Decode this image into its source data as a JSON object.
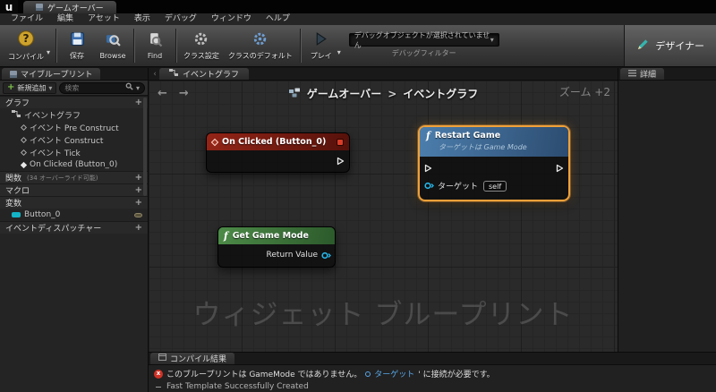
{
  "window": {
    "logo_letter": "u",
    "doc_tab_label": "ゲームオーバー"
  },
  "menu_bar": {
    "items": [
      "ファイル",
      "編集",
      "アセット",
      "表示",
      "デバッグ",
      "ウィンドウ",
      "ヘルプ"
    ]
  },
  "toolbar": {
    "compile_label": "コンパイル",
    "save_label": "保存",
    "browse_label": "Browse",
    "find_label": "Find",
    "class_settings_label": "クラス設定",
    "class_defaults_label": "クラスのデフォルト",
    "play_label": "プレイ",
    "debug_filter_value": "デバッグオブジェクトが選択されていません",
    "debug_filter_label": "デバッグフィルター",
    "designer_label": "デザイナー"
  },
  "my_blueprint": {
    "panel_title": "マイブループリント",
    "add_new_label": "新規追加",
    "search_placeholder": "検索",
    "graph_section_label": "グラフ",
    "event_graph_label": "イベントグラフ",
    "events": [
      "イベント Pre Construct",
      "イベント Construct",
      "イベント Tick",
      "On Clicked (Button_0)"
    ],
    "functions_label": "関数",
    "functions_hint": "(34 オーバーライド可能)",
    "macro_label": "マクロ",
    "variables_label": "変数",
    "variable_name": "Button_0",
    "dispatcher_label": "イベントディスパッチャー"
  },
  "graph": {
    "tab_label": "イベントグラフ",
    "breadcrumb_root": "ゲームオーバー",
    "breadcrumb_separator": ">",
    "breadcrumb_current": "イベントグラフ",
    "zoom_label": "ズーム +2",
    "watermark": "ウィジェット ブループリント",
    "nodes": {
      "on_clicked": {
        "title": "On Clicked (Button_0)"
      },
      "restart_game": {
        "fn_letter": "f",
        "title": "Restart Game",
        "subtitle": "ターゲットは Game Mode",
        "target_pin_label": "ターゲット",
        "self_value": "self"
      },
      "get_game_mode": {
        "fn_letter": "f",
        "title": "Get Game Mode",
        "return_pin_label": "Return Value"
      }
    }
  },
  "details_panel": {
    "title": "詳細"
  },
  "compile_results": {
    "tab_label": "コンパイル結果",
    "error_prefix": "このブループリントは GameMode ではありません。",
    "error_link": "ターゲット",
    "error_suffix": "' に接続が必要です。",
    "info_text": "Fast Template Successfully Created"
  },
  "icons": {
    "caret_down": "▾",
    "nav_left": "←",
    "nav_right": "→",
    "plus": "+",
    "error_x": "x",
    "tab_scroll": "‹"
  },
  "colors": {
    "selection_orange": "#f0a13a",
    "event_node_red": "#932416",
    "function_node_blue": "#4c7ead",
    "pure_node_green": "#4d8b48",
    "pin_cyan": "#27b7ea",
    "error_red": "#cf3226",
    "link_blue": "#58a7e8"
  }
}
